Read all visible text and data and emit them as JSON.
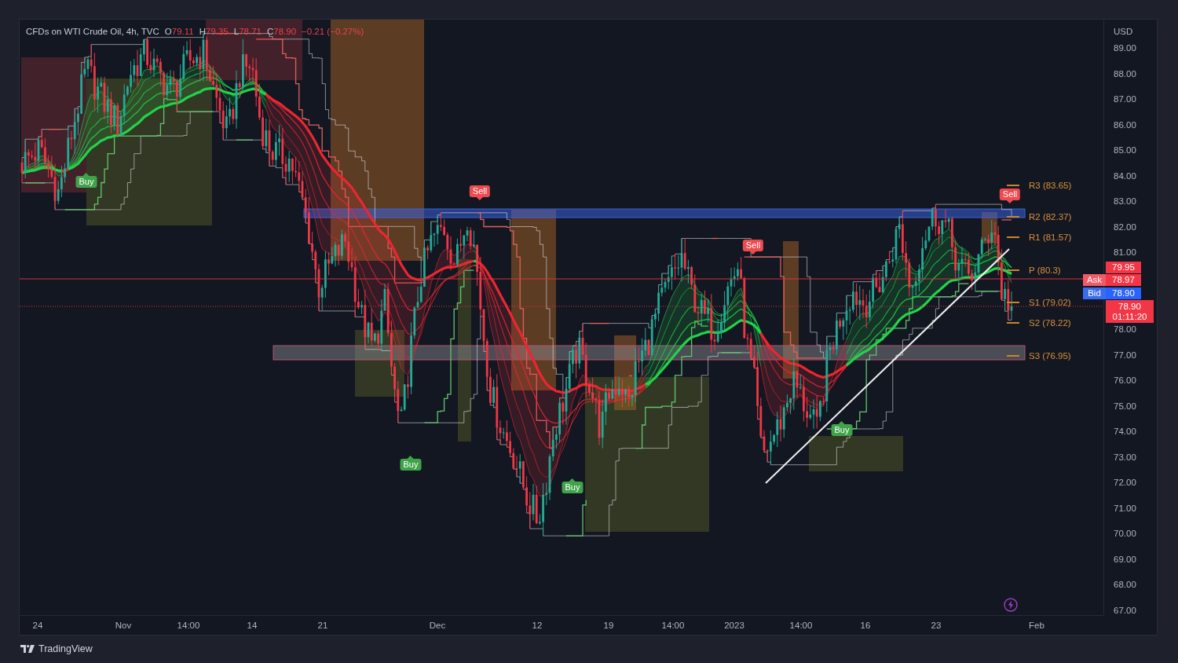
{
  "chart": {
    "title": "CFDs on WTI Crude Oil, 4h, TVC",
    "ohlc": [
      {
        "label": "O",
        "value": "79.11"
      },
      {
        "label": "H",
        "value": "79.35"
      },
      {
        "label": "L",
        "value": "78.71"
      },
      {
        "label": "C",
        "value": "78.90"
      }
    ],
    "change": "−0.21 (−0.27%)",
    "signals": [
      {
        "kind": "buy",
        "label": "Buy"
      },
      {
        "kind": "buy",
        "label": "Buy"
      },
      {
        "kind": "sell",
        "label": "Sell"
      },
      {
        "kind": "buy",
        "label": "Buy"
      },
      {
        "kind": "sell",
        "label": "Sell"
      },
      {
        "kind": "buy",
        "label": "Buy"
      },
      {
        "kind": "sell",
        "label": "Sell"
      }
    ],
    "pivot_levels": [
      "R3 (83.65)",
      "R2 (82.37)",
      "R1 (81.57)",
      "P (80.3)",
      "S1 (79.02)",
      "S2 (78.22)",
      "S3 (76.95)"
    ],
    "price_tags": [
      {
        "kind": "marker",
        "value": "79.95"
      },
      {
        "kind": "ask",
        "label": "Ask",
        "value": "78.97"
      },
      {
        "kind": "bid",
        "label": "Bid",
        "value": "78.90"
      },
      {
        "kind": "last",
        "value": "78.90",
        "countdown": "01:11:20"
      }
    ]
  },
  "price_axis": {
    "currency": "USD",
    "ticks": [
      "89.00",
      "88.00",
      "87.00",
      "86.00",
      "85.00",
      "84.00",
      "83.00",
      "82.00",
      "81.00",
      "78.00",
      "77.00",
      "76.00",
      "75.00",
      "74.00",
      "73.00",
      "72.00",
      "71.00",
      "70.00",
      "69.00",
      "68.00",
      "67.00"
    ]
  },
  "time_axis": {
    "labels": [
      "24",
      "Nov",
      "14:00",
      "14",
      "21",
      "Dec",
      "12",
      "19",
      "14:00",
      "2023",
      "14:00",
      "16",
      "23",
      "Feb"
    ]
  },
  "footer": {
    "brand": "TradingView"
  }
}
